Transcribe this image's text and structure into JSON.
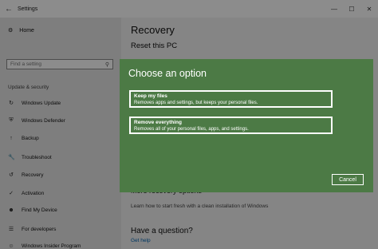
{
  "window": {
    "title": "Settings",
    "back_icon": "back-arrow-icon",
    "controls": [
      "minimize-icon",
      "maximize-icon",
      "close-icon"
    ]
  },
  "sidebar": {
    "home_label": "Home",
    "search_placeholder": "Find a setting",
    "section_label": "Update & security",
    "items": [
      {
        "label": "Windows Update",
        "icon": "sync-icon"
      },
      {
        "label": "Windows Defender",
        "icon": "shield-icon"
      },
      {
        "label": "Backup",
        "icon": "backup-arrow-icon"
      },
      {
        "label": "Troubleshoot",
        "icon": "wrench-icon"
      },
      {
        "label": "Recovery",
        "icon": "recovery-icon"
      },
      {
        "label": "Activation",
        "icon": "check-circle-icon"
      },
      {
        "label": "Find My Device",
        "icon": "person-device-icon"
      },
      {
        "label": "For developers",
        "icon": "developer-icon"
      },
      {
        "label": "Windows Insider Program",
        "icon": "insider-icon"
      }
    ]
  },
  "main": {
    "page_title": "Recovery",
    "subheading": "Reset this PC",
    "more_heading": "More recovery options",
    "fresh_link": "Learn how to start fresh with a clean installation of Windows",
    "question_title": "Have a question?",
    "help_link": "Get help"
  },
  "dialog": {
    "title": "Choose an option",
    "options": [
      {
        "title": "Keep my files",
        "description": "Removes apps and settings, but keeps your personal files."
      },
      {
        "title": "Remove everything",
        "description": "Removes all of your personal files, apps, and settings."
      }
    ],
    "cancel_label": "Cancel"
  },
  "colors": {
    "dialog_bg": "#4c7a45",
    "link": "#0063b1"
  }
}
